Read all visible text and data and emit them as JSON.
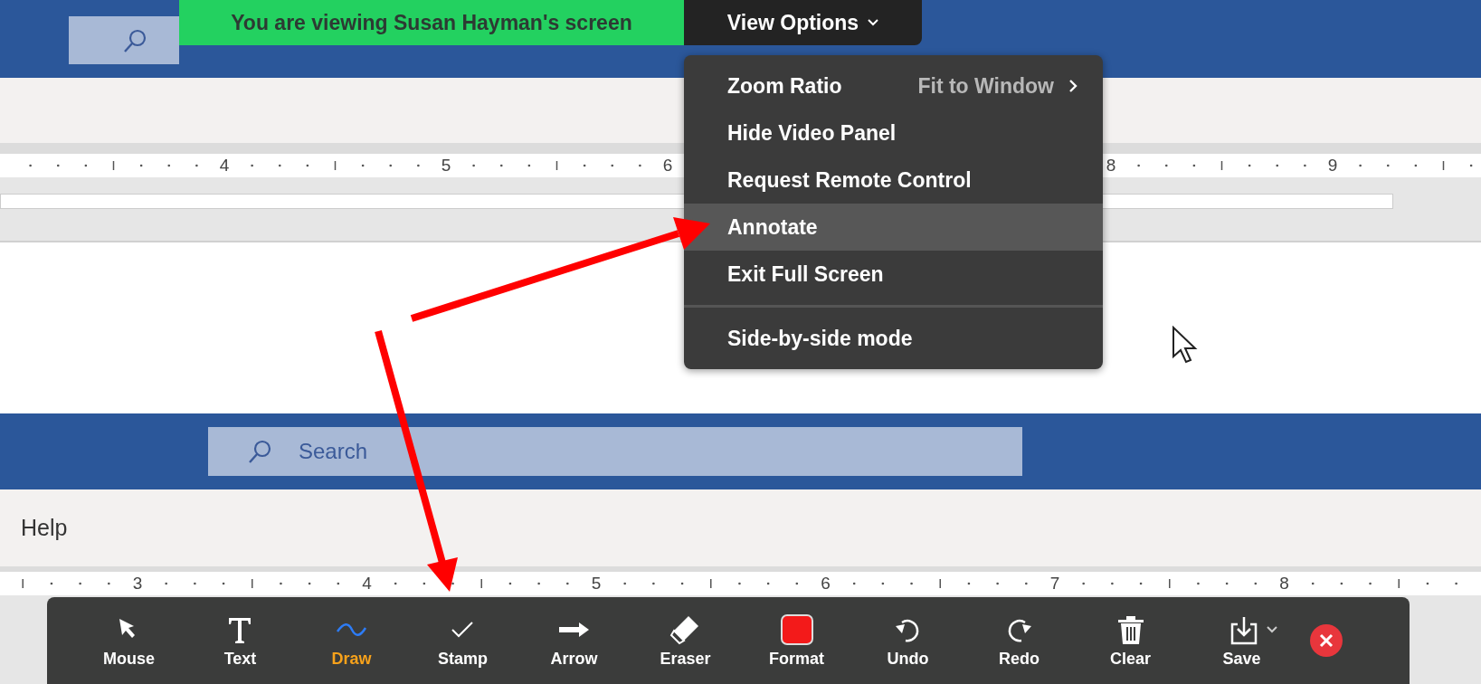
{
  "top_document": {
    "ruler": [
      "4",
      "5",
      "6",
      "8",
      "9"
    ]
  },
  "share_banner": {
    "text": "You are viewing Susan Hayman's screen",
    "view_options": "View Options",
    "expanded": true
  },
  "view_options_menu": {
    "groups": [
      [
        {
          "label": "Zoom Ratio",
          "value": "Fit to Window",
          "submenu": true,
          "selected": false
        },
        {
          "label": "Hide Video Panel",
          "selected": false
        },
        {
          "label": "Request Remote Control",
          "selected": false
        },
        {
          "label": "Annotate",
          "selected": true
        },
        {
          "label": "Exit Full Screen",
          "selected": false
        }
      ],
      [
        {
          "label": "Side-by-side mode",
          "selected": false
        }
      ]
    ]
  },
  "bottom_document": {
    "search": {
      "placeholder": "Search"
    },
    "ribbon_tab": "Help",
    "ruler": [
      "3",
      "4",
      "5",
      "6",
      "7",
      "8"
    ]
  },
  "annotation_toolbar": {
    "tools": [
      {
        "kind": "mouse",
        "label": "Mouse",
        "selected": false
      },
      {
        "kind": "text",
        "label": "Text",
        "selected": false
      },
      {
        "kind": "draw",
        "label": "Draw",
        "selected": true
      },
      {
        "kind": "stamp",
        "label": "Stamp",
        "selected": false
      },
      {
        "kind": "arrow",
        "label": "Arrow",
        "selected": false
      },
      {
        "kind": "eraser",
        "label": "Eraser",
        "selected": false
      },
      {
        "kind": "format",
        "label": "Format",
        "selected": false
      },
      {
        "kind": "undo",
        "label": "Undo",
        "selected": false
      },
      {
        "kind": "redo",
        "label": "Redo",
        "selected": false
      },
      {
        "kind": "clear",
        "label": "Clear",
        "selected": false
      },
      {
        "kind": "save",
        "label": "Save",
        "selected": false
      }
    ]
  }
}
